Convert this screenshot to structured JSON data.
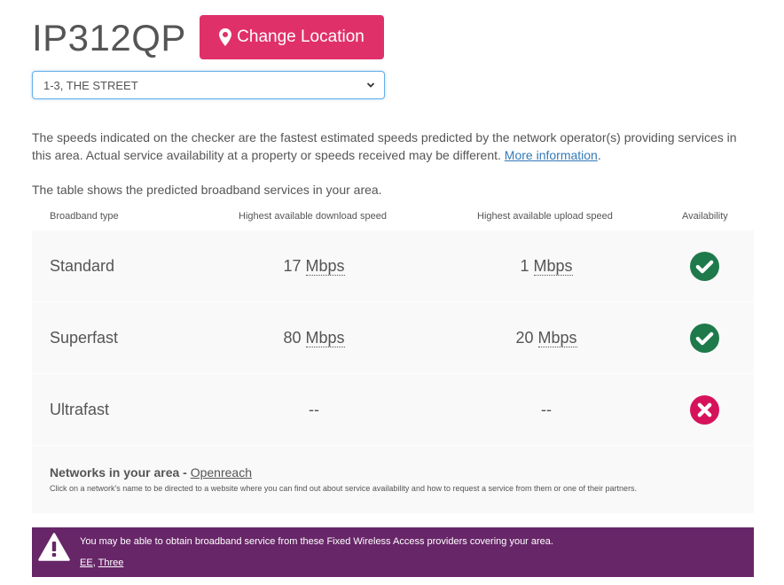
{
  "header": {
    "postcode": "IP312QP",
    "change_location_label": "Change Location",
    "pin_icon": "map-marker-icon"
  },
  "address_select": {
    "selected": "1-3, THE STREET"
  },
  "intro": {
    "text": "The speeds indicated on the checker are the fastest estimated speeds predicted by the network operator(s) providing services in this area. Actual service availability at a property or speeds received may be different. ",
    "link": "More information",
    "after_link": ".",
    "table_intro": "The table shows the predicted broadband services in your area."
  },
  "table": {
    "headers": [
      "Broadband type",
      "Highest available download speed",
      "Highest available upload speed",
      "Availability"
    ],
    "rows": [
      {
        "type": "Standard",
        "download": "17",
        "download_unit": "Mbps",
        "upload": "1",
        "upload_unit": "Mbps",
        "available": true
      },
      {
        "type": "Superfast",
        "download": "80",
        "download_unit": "Mbps",
        "upload": "20",
        "upload_unit": "Mbps",
        "available": true
      },
      {
        "type": "Ultrafast",
        "download": "--",
        "download_unit": "",
        "upload": "--",
        "upload_unit": "",
        "available": false
      }
    ]
  },
  "networks": {
    "label": "Networks in your area - ",
    "link": "Openreach",
    "note": "Click on a network's name to be directed to a website where you can find out about service availability and how to request a service from them or one of their partners."
  },
  "banner": {
    "message": "You may be able to obtain broadband service from these Fixed Wireless Access providers covering your area.",
    "providers": [
      "EE",
      "Three"
    ],
    "separator": ", ",
    "color": "#672668"
  },
  "colors": {
    "accent": "#e0306a",
    "available": "#1e7a4a",
    "unavailable": "#d6135a",
    "link": "#337ab7"
  }
}
